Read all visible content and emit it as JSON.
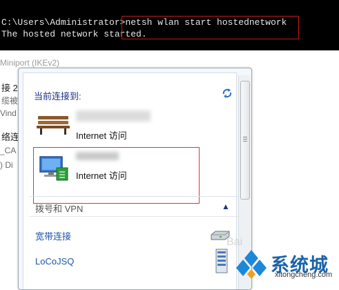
{
  "console": {
    "line1_prefix": "C:\\Users\\Administrator>",
    "line1_command": "netsh wlan start hostednetwork",
    "line2": "The hosted network started."
  },
  "background": {
    "line_miniport": "Miniport (IKEv2)",
    "line_a": "接 2",
    "line_b": "缆被",
    "line_c": "Vind",
    "line_d": "络连",
    "line_e": "_CA",
    "line_f": ") Di"
  },
  "flyout": {
    "title": "当前连接到:",
    "network1_label": "Internet 访问",
    "network2_label": "Internet 访问",
    "section_title": "拨号和 VPN",
    "items": [
      {
        "label": "宽带连接"
      },
      {
        "label": "LoCoJSQ"
      }
    ]
  },
  "watermark": {
    "baidu": "Bai",
    "site_name": "系统城",
    "site_url": "xitongcheng.com"
  },
  "colors": {
    "highlight_red": "#d9353a",
    "link_blue": "#1e55a8",
    "title_blue": "#1e3287"
  }
}
